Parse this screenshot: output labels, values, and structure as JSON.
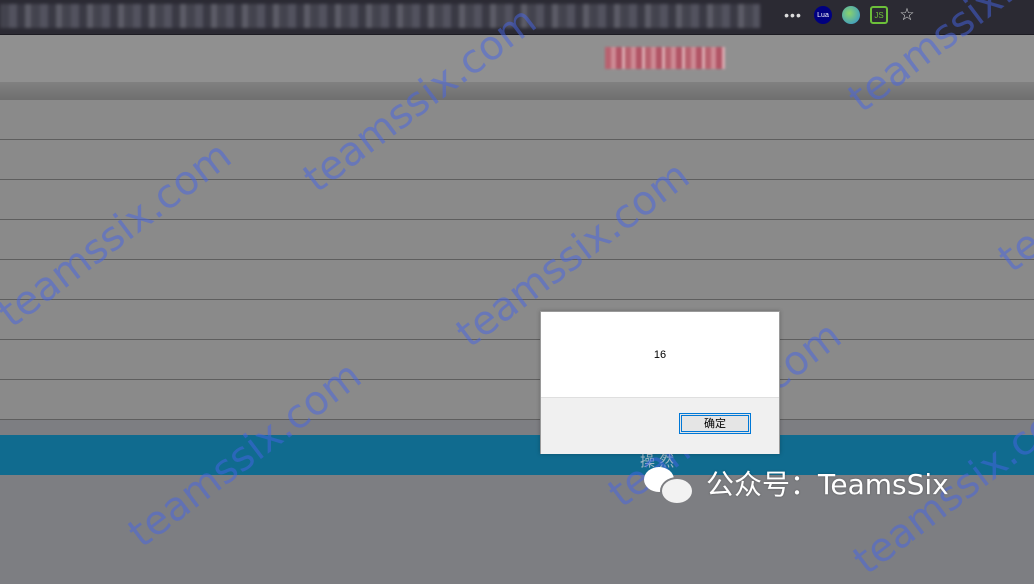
{
  "browser": {
    "icons": [
      "more-icon",
      "lua-extension-icon",
      "globe-extension-icon",
      "js-extension-icon",
      "bookmark-star-icon"
    ],
    "more_label": "•••",
    "lua_label": "Lua",
    "js_label": "JS",
    "star_label": "☆"
  },
  "page": {
    "footer_text": "操 然"
  },
  "watermark": "teamssix.com",
  "dialog": {
    "message": "16",
    "ok_label": "确定"
  },
  "wechat": {
    "label": "公众号：TeamsSix"
  },
  "colors": {
    "toolbar": "#2b2a33",
    "blue_bar": "#106b8f",
    "watermark": "#4664e6"
  }
}
